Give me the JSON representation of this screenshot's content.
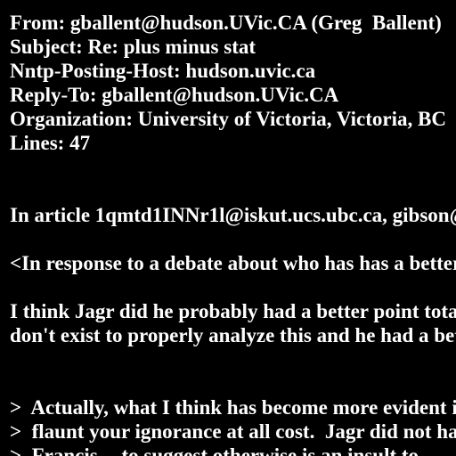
{
  "colors": {
    "background": "#000000",
    "text": "#ffffff"
  },
  "header": {
    "from": "From: gballent@hudson.UVic.CA (Greg  Ballent)",
    "subject": "Subject: Re: plus minus stat",
    "nntp_host": "Nntp-Posting-Host: hudson.uvic.ca",
    "reply_to": "Reply-To: gballent@hudson.UVic.CA",
    "organization": "Organization: University of Victoria, Victoria, BC",
    "lines": "Lines: 47"
  },
  "body": {
    "attribution": "In article 1qmtd1INNr1l@iskut.ucs.ubc.ca, gibson@nukta.geop.ubc.ca",
    "intro": "<In response to a debate about who has has a better plus minus",
    "para_1": "I think Jagr did he probably had a better point totals. The statistics",
    "para_2": "don't exist to properly analyze this and he had a better",
    "quote_1": ">  Actually, what I think has become more evident is that you want to",
    "quote_2": ">  flaunt your ignorance at all cost.  Jagr did not have better",
    "quote_3": ">  Francis -- to suggest otherwise is an insult to"
  }
}
